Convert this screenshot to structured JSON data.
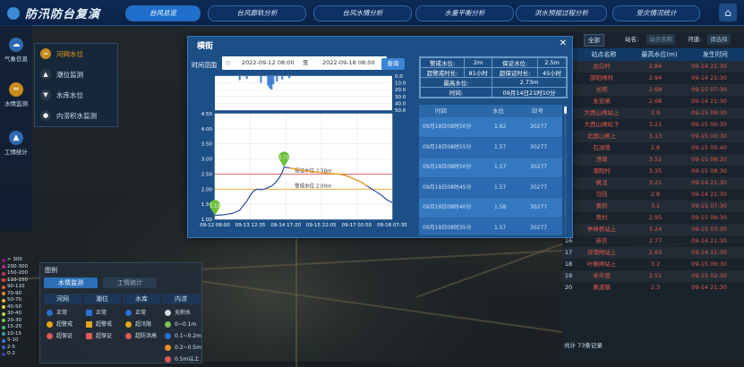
{
  "app": {
    "title": "防汛防台复演"
  },
  "nav": [
    {
      "label": "台风总览",
      "active": true
    },
    {
      "label": "台风廊轨分析"
    },
    {
      "label": "台风水情分析"
    },
    {
      "label": "水量平衡分析"
    },
    {
      "label": "洪水预报过程分析"
    },
    {
      "label": "受灾情况统计"
    }
  ],
  "sidebar": [
    {
      "label": "气象信息",
      "icon": "weather-icon"
    },
    {
      "label": "水情监测",
      "icon": "water-monitor-icon",
      "active": true
    },
    {
      "label": "工情统计",
      "icon": "engineering-icon"
    }
  ],
  "submenu": [
    {
      "label": "河网水位",
      "active": true
    },
    {
      "label": "潮位监测"
    },
    {
      "label": "水库水位"
    },
    {
      "label": "内涝积水监测"
    }
  ],
  "right_panel": {
    "filter_label": "全部",
    "station_label": "站名:",
    "station_placeholder": "站点名称",
    "basin_label": "河道:",
    "basin_value": "请选择",
    "columns": [
      "站点名称",
      "最高水位(m)",
      "发生时间"
    ],
    "rows": [
      [
        "古白村",
        "2.84",
        "09-14 21:30"
      ],
      [
        "邵阳闸村",
        "2.94",
        "09-14 21:30"
      ],
      [
        "光明",
        "2.68",
        "09-15 07:30"
      ],
      [
        "永安闸",
        "2.68",
        "09-14 21:30"
      ],
      [
        "大西山闸站上",
        "2.9",
        "09-15 09:30"
      ],
      [
        "大西山闸站下",
        "3.21",
        "09-15 00:30"
      ],
      [
        "北面山闸上",
        "3.13",
        "09-15 00:30"
      ],
      [
        "石湖荡",
        "2.8",
        "09-15 05:40"
      ],
      [
        "澄墩",
        "3.52",
        "09-15 08:30"
      ],
      [
        "潮阳村",
        "3.35",
        "09-15 08:30"
      ],
      [
        "枫泾",
        "3.21",
        "09-14 21:30"
      ],
      [
        "马陆",
        "2.8",
        "09-14 21:30"
      ],
      [
        "黄桥",
        "3.1",
        "09-15 07:30"
      ],
      [
        "青村",
        "2.95",
        "09-15 06:30"
      ],
      [
        "亭林桥站上",
        "3.24",
        "09-15 03:30"
      ],
      [
        "新农",
        "2.77",
        "09-14 21:30"
      ],
      [
        "泖港闸站上",
        "2.63",
        "09-14 21:30"
      ],
      [
        "叶榭闸站上",
        "3.2",
        "09-15 06:30"
      ],
      [
        "米市渡",
        "2.51",
        "09-15 02:30"
      ],
      [
        "黄渡镇",
        "2.3",
        "09-14 21:30"
      ]
    ],
    "footer": "共计 73条记录"
  },
  "legend": {
    "title": "图例",
    "tabs": [
      "水情监测",
      "工情统计"
    ],
    "columns": [
      {
        "head": "河网",
        "items": [
          "正常",
          "超警戒",
          "超保证"
        ]
      },
      {
        "head": "潮位",
        "items": [
          "正常",
          "超警戒",
          "超保证"
        ]
      },
      {
        "head": "水库",
        "items": [
          "正常",
          "超汛限",
          "超防洪高"
        ]
      },
      {
        "head": "内涝",
        "items": [
          "无积水",
          "0~0.1m",
          "0.1~0.2m",
          "0.2~0.5m",
          "0.5m以上"
        ]
      }
    ],
    "scale": [
      "> 300",
      "200-300",
      "150-200",
      "110-150",
      "90-110",
      "70-90",
      "50-70",
      "40-50",
      "30-40",
      "20-30",
      "15-20",
      "10-15",
      "5-10",
      "2-5",
      "0-2"
    ],
    "scale_colors": [
      "#7e1f86",
      "#b02a8c",
      "#cf2c61",
      "#e03a3a",
      "#e55c2a",
      "#f08b2a",
      "#f2b93a",
      "#e3d64a",
      "#b8d44e",
      "#7cc35a",
      "#53b07c",
      "#3a9bb4",
      "#3a7ed2",
      "#3a5ec7",
      "#3a3fa8"
    ]
  },
  "modal": {
    "title": "横街",
    "time_label": "时间范围",
    "start": "2022-09-12 08:00",
    "sep": "至",
    "end": "2022-09-18 08:00",
    "query": "查询",
    "info": {
      "warn_label": "警戒水位:",
      "warn_value": "2m",
      "guar_label": "保证水位:",
      "guar_value": "2.5m",
      "over_warn_label": "超警戒时长:",
      "over_warn_value": "81小时",
      "over_guar_label": "超保证时长:",
      "over_guar_value": "45小时",
      "max_label": "最高水位:",
      "max_value": "2.73m",
      "time_label": "时间:",
      "time_value": "09月14日21时10分"
    },
    "list_cols": [
      "时间",
      "水位",
      "印号"
    ],
    "list_rows": [
      [
        "09月18日08时50分",
        "1.62",
        "30277"
      ],
      [
        "09月18日08时55分",
        "1.57",
        "30277"
      ],
      [
        "09月18日08时50分",
        "1.57",
        "30277"
      ],
      [
        "09月18日08时45分",
        "1.57",
        "30277"
      ],
      [
        "09月18日08时40分",
        "1.58",
        "30277"
      ],
      [
        "09月18日08时35分",
        "1.57",
        "30277"
      ],
      [
        "09月18日08时30分",
        "1.58",
        "30277"
      ]
    ]
  },
  "chart_data": {
    "type": "line",
    "xlabel": "",
    "ylabel": "",
    "x_ticks": [
      "09-12 08:00",
      "09-13 12:35",
      "09-14 17:20",
      "09-15 22:05",
      "09-17 02:50",
      "09-18 07:35"
    ],
    "ylim": [
      1.0,
      4.5
    ],
    "y_ticks": [
      "1.00",
      "1.50",
      "2.00",
      "2.50",
      "3.00",
      "3.50",
      "4.00",
      "4.50"
    ],
    "rain_ylim": [
      0,
      50
    ],
    "rain_ticks": [
      "0.0",
      "10.0",
      "20.0",
      "30.0",
      "40.0",
      "50.0"
    ],
    "warn_line": {
      "value": 2.0,
      "label": "警戒水位 2.00m",
      "color": "#e6a417"
    },
    "guar_line": {
      "value": 2.5,
      "label": "保证水位 2.50m",
      "color": "#e05858"
    },
    "markers": [
      {
        "label": "1.13",
        "x": 0.0,
        "y": 1.13,
        "color": "#6bbf3a"
      },
      {
        "label": "2.73",
        "x": 0.39,
        "y": 2.73,
        "color": "#6bbf3a"
      }
    ],
    "series": [
      {
        "values_x": [
          0.0,
          0.05,
          0.1,
          0.14,
          0.16,
          0.18,
          0.2,
          0.22,
          0.24,
          0.26,
          0.28,
          0.3,
          0.32,
          0.34,
          0.36,
          0.38,
          0.39,
          0.42,
          0.46,
          0.5,
          0.55,
          0.6,
          0.65,
          0.7,
          0.74,
          0.78,
          0.82,
          0.86,
          0.9,
          0.94,
          0.97,
          1.0
        ],
        "values_y": [
          1.13,
          1.15,
          1.2,
          1.3,
          1.45,
          1.6,
          1.8,
          1.95,
          2.0,
          1.98,
          2.0,
          2.05,
          2.1,
          2.2,
          2.35,
          2.55,
          2.73,
          2.7,
          2.66,
          2.62,
          2.58,
          2.55,
          2.52,
          2.5,
          2.45,
          2.35,
          2.25,
          2.1,
          1.95,
          1.8,
          1.65,
          1.55
        ]
      }
    ],
    "rain": [
      {
        "x": 0.14,
        "v": 6
      },
      {
        "x": 0.18,
        "v": 4
      },
      {
        "x": 0.26,
        "v": 10
      },
      {
        "x": 0.3,
        "v": 14
      },
      {
        "x": 0.31,
        "v": 18
      },
      {
        "x": 0.32,
        "v": 20
      },
      {
        "x": 0.33,
        "v": 12
      },
      {
        "x": 0.35,
        "v": 8
      },
      {
        "x": 0.38,
        "v": 5
      },
      {
        "x": 0.42,
        "v": 3
      }
    ]
  }
}
